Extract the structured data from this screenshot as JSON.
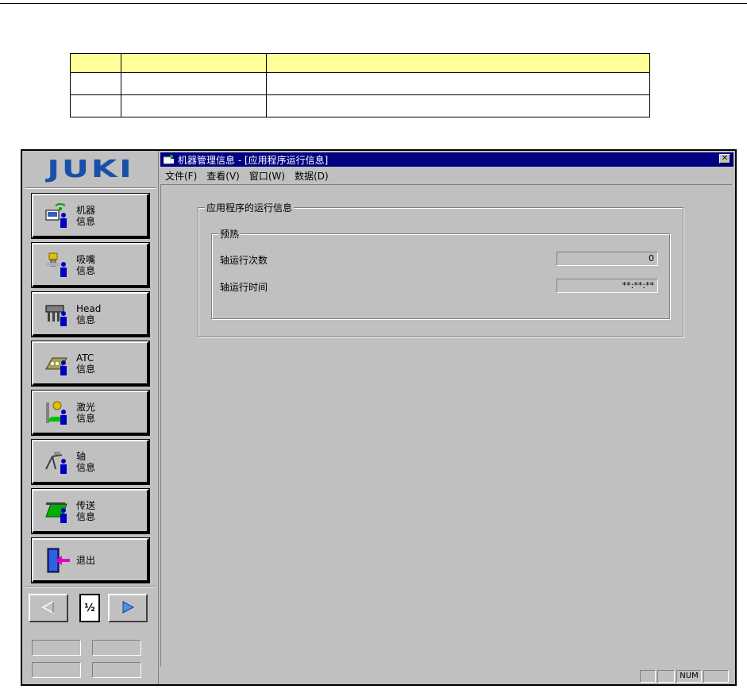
{
  "doc_table": {
    "rows": [
      [
        "",
        "",
        ""
      ],
      [
        "",
        "",
        ""
      ],
      [
        "",
        "",
        ""
      ]
    ]
  },
  "sidebar": {
    "logo": "JUKI",
    "items": [
      {
        "line1": "机器",
        "line2": "信息",
        "icon": "machine-info-icon"
      },
      {
        "line1": "吸嘴",
        "line2": "信息",
        "icon": "nozzle-info-icon"
      },
      {
        "line1": "Head",
        "line2": "信息",
        "icon": "head-info-icon"
      },
      {
        "line1": "ATC",
        "line2": "信息",
        "icon": "atc-info-icon"
      },
      {
        "line1": "激光",
        "line2": "信息",
        "icon": "laser-info-icon"
      },
      {
        "line1": "轴",
        "line2": "信息",
        "icon": "axis-info-icon"
      },
      {
        "line1": "传送",
        "line2": "信息",
        "icon": "conveyor-info-icon"
      },
      {
        "line1": "退出",
        "line2": "",
        "icon": "exit-door-icon"
      }
    ],
    "page": "½"
  },
  "window": {
    "title": "机器管理信息 - [应用程序运行信息]",
    "close_glyph": "✕",
    "menu": [
      "文件(F)",
      "查看(V)",
      "窗口(W)",
      "数据(D)"
    ]
  },
  "content": {
    "group_title": "应用程序的运行信息",
    "subgroup_title": "预热",
    "rows": [
      {
        "label": "轴运行次数",
        "value": "0"
      },
      {
        "label": "轴运行时间",
        "value": "**:**:**"
      }
    ]
  },
  "statusbar": {
    "num": "NUM"
  },
  "colors": {
    "face": "#c0c0c0",
    "titlebar": "#000080",
    "logo": "#1a4fa8",
    "table_header": "#ffff99"
  }
}
